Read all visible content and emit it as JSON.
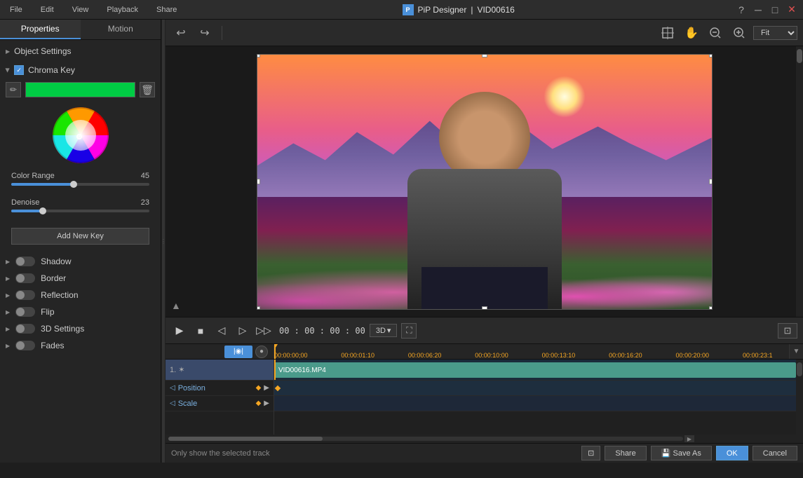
{
  "titleBar": {
    "appName": "PiP Designer",
    "fileName": "VID00616",
    "separator": "|",
    "helpBtn": "?",
    "minimizeBtn": "─",
    "maximizeBtn": "□",
    "closeBtn": "✕"
  },
  "menuBar": {
    "items": [
      "File",
      "Edit",
      "View",
      "Playback",
      "Share"
    ]
  },
  "leftPanel": {
    "tabs": [
      "Properties",
      "Motion"
    ],
    "activeTab": "Properties",
    "objectSettings": {
      "label": "Object Settings"
    },
    "chromaKey": {
      "label": "Chroma Key",
      "checked": true,
      "colorRange": {
        "label": "Color Range",
        "value": "45",
        "percent": 45
      },
      "denoise": {
        "label": "Denoise",
        "value": "23",
        "percent": 23
      },
      "addKeyBtn": "Add New Key"
    },
    "sections": [
      {
        "id": "shadow",
        "label": "Shadow",
        "enabled": false
      },
      {
        "id": "border",
        "label": "Border",
        "enabled": false
      },
      {
        "id": "reflection",
        "label": "Reflection",
        "enabled": false
      },
      {
        "id": "flip",
        "label": "Flip",
        "enabled": false
      },
      {
        "id": "3d-settings",
        "label": "3D Settings",
        "enabled": false
      },
      {
        "id": "fades",
        "label": "Fades",
        "enabled": false
      }
    ]
  },
  "toolbar": {
    "undo": "↩",
    "redo": "↪",
    "select": "⊕",
    "hand": "✋",
    "zoomOut": "−",
    "zoomIn": "+",
    "fit": "Fit",
    "fitDropdown": "▼"
  },
  "playback": {
    "timecode": "00 : 00 : 00 : 00",
    "mode3D": "3D",
    "playBtn": "▶",
    "stopBtn": "■",
    "prevFrameBtn": "◁",
    "nextFrameBtn": "▷",
    "fastForwardBtn": "▷▷"
  },
  "timeline": {
    "rulerMarks": [
      {
        "label": "00:00:00;00",
        "pos": 0
      },
      {
        "label": "00:00:01:10",
        "pos": 13
      },
      {
        "label": "00:00:06:20",
        "pos": 26
      },
      {
        "label": "00:00:10:00",
        "pos": 39
      },
      {
        "label": "00:00:13:10",
        "pos": 52
      },
      {
        "label": "00:00:16:20",
        "pos": 65
      },
      {
        "label": "00:00:20:00",
        "pos": 78
      },
      {
        "label": "00:00:23:1",
        "pos": 91
      }
    ],
    "tracks": [
      {
        "id": "video1",
        "label": "1. ✶",
        "clipName": "VID00616.MP4",
        "selected": true
      },
      {
        "id": "position",
        "label": "Position",
        "isKeyframe": true
      },
      {
        "id": "scale",
        "label": "Scale",
        "isKeyframe": true
      }
    ],
    "playheadPos": 0
  },
  "bottomBar": {
    "onlyShowLabel": "Only show the selected track",
    "buttons": [
      {
        "id": "screen-btn",
        "icon": "⊡"
      },
      {
        "id": "share-btn",
        "label": "Share"
      },
      {
        "id": "save-as-btn",
        "label": "Save As",
        "icon": "💾"
      },
      {
        "id": "ok-btn",
        "label": "OK"
      },
      {
        "id": "cancel-btn",
        "label": "Cancel"
      }
    ]
  }
}
